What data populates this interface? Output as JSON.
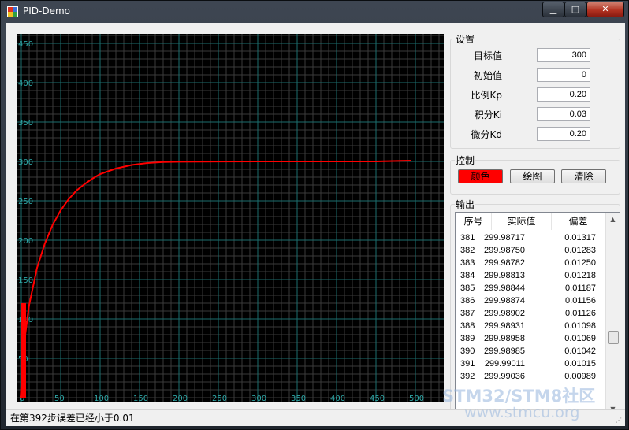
{
  "window": {
    "title": "PID-Demo",
    "minimize": "▁",
    "maximize": "□",
    "close": "✕"
  },
  "settings": {
    "title": "设置",
    "fields": [
      {
        "label": "目标值",
        "value": "300"
      },
      {
        "label": "初始值",
        "value": "0"
      },
      {
        "label": "比例Kp",
        "value": "0.20"
      },
      {
        "label": "积分Ki",
        "value": "0.03"
      },
      {
        "label": "微分Kd",
        "value": "0.20"
      }
    ]
  },
  "control": {
    "title": "控制",
    "color_label": "颜色",
    "plot_label": "绘图",
    "clear_label": "清除",
    "color_value": "#ff0000"
  },
  "output": {
    "title": "输出",
    "headers": [
      "序号",
      "实际值",
      "偏差"
    ],
    "rows": [
      [
        "381",
        "299.98717",
        "0.01317"
      ],
      [
        "382",
        "299.98750",
        "0.01283"
      ],
      [
        "383",
        "299.98782",
        "0.01250"
      ],
      [
        "384",
        "299.98813",
        "0.01218"
      ],
      [
        "385",
        "299.98844",
        "0.01187"
      ],
      [
        "386",
        "299.98874",
        "0.01156"
      ],
      [
        "387",
        "299.98902",
        "0.01126"
      ],
      [
        "388",
        "299.98931",
        "0.01098"
      ],
      [
        "389",
        "299.98958",
        "0.01069"
      ],
      [
        "390",
        "299.98985",
        "0.01042"
      ],
      [
        "391",
        "299.99011",
        "0.01015"
      ],
      [
        "392",
        "299.99036",
        "0.00989"
      ]
    ]
  },
  "status": {
    "text": "在第392步误差已经小于0.01"
  },
  "watermark": {
    "line1": "STM32/STM8社区",
    "line2": "www.stmcu.org"
  },
  "chart_data": {
    "type": "line",
    "xlim": [
      0,
      540
    ],
    "ylim": [
      0,
      468
    ],
    "x_ticks": [
      0,
      50,
      100,
      150,
      200,
      250,
      300,
      350,
      400,
      450,
      500
    ],
    "y_ticks": [
      50,
      100,
      150,
      200,
      250,
      300,
      350,
      400,
      450
    ],
    "grid": true,
    "series": [
      {
        "color": "#ff0000",
        "x": [
          0,
          5,
          10,
          20,
          30,
          40,
          50,
          60,
          70,
          80,
          90,
          100,
          120,
          140,
          160,
          180,
          200,
          250,
          300,
          392,
          450,
          495
        ],
        "y": [
          0,
          80,
          118,
          165,
          196,
          220,
          238,
          252,
          263,
          271,
          278,
          284,
          291,
          295.5,
          298,
          299.2,
          299.6,
          299.9,
          299.95,
          299.99,
          300,
          301
        ]
      }
    ],
    "initial_bar": {
      "x_from": 0,
      "x_to": 6,
      "y": 120
    }
  }
}
